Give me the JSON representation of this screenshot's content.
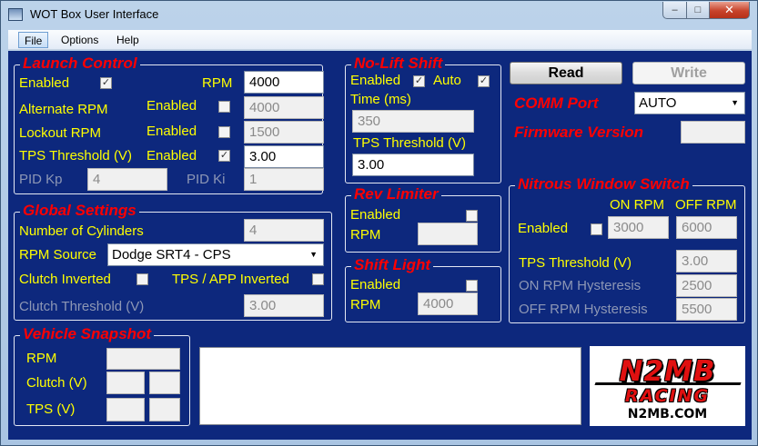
{
  "window": {
    "title": "WOT Box User Interface",
    "minimize": "–",
    "maximize": "□",
    "close": "✕"
  },
  "menu": {
    "file": "File",
    "options": "Options",
    "help": "Help"
  },
  "launch": {
    "title": "Launch Control",
    "enabled_label": "Enabled",
    "enabled_checked": "✓",
    "rpm_label": "RPM",
    "rpm_value": "4000",
    "alt_label": "Alternate RPM",
    "alt_enabled_label": "Enabled",
    "alt_value": "4000",
    "lockout_label": "Lockout  RPM",
    "lockout_enabled_label": "Enabled",
    "lockout_value": "1500",
    "tps_label": "TPS Threshold (V)",
    "tps_enabled_label": "Enabled",
    "tps_checked": "✓",
    "tps_value": "3.00",
    "pidkp_label": "PID Kp",
    "pidkp_value": "4",
    "pidki_label": "PID Ki",
    "pidki_value": "1"
  },
  "global": {
    "title": "Global Settings",
    "cyl_label": "Number of Cylinders",
    "cyl_value": "4",
    "rpm_source_label": "RPM Source",
    "rpm_source_value": "Dodge SRT4 - CPS",
    "clutch_inv_label": "Clutch Inverted",
    "tps_inv_label": "TPS / APP Inverted",
    "clutch_thresh_label": "Clutch Threshold (V)",
    "clutch_thresh_value": "3.00"
  },
  "snapshot": {
    "title": "Vehicle Snapshot",
    "rpm_label": "RPM",
    "clutch_label": "Clutch (V)",
    "tps_label": "TPS (V)"
  },
  "nolift": {
    "title": "No-Lift Shift",
    "enabled_label": "Enabled",
    "enabled_checked": "✓",
    "auto_label": "Auto",
    "auto_checked": "✓",
    "time_label": "Time (ms)",
    "time_value": "350",
    "tps_label": "TPS Threshold (V)",
    "tps_value": "3.00"
  },
  "revlimiter": {
    "title": "Rev Limiter",
    "enabled_label": "Enabled",
    "rpm_label": "RPM"
  },
  "shiftlight": {
    "title": "Shift Light",
    "enabled_label": "Enabled",
    "rpm_label": "RPM",
    "rpm_value": "4000"
  },
  "top": {
    "read_label": "Read",
    "write_label": "Write",
    "comm_label": "COMM Port",
    "comm_value": "AUTO",
    "firmware_label": "Firmware Version"
  },
  "nitrous": {
    "title": "Nitrous Window Switch",
    "on_rpm_header": "ON RPM",
    "off_rpm_header": "OFF RPM",
    "enabled_label": "Enabled",
    "on_rpm_value": "3000",
    "off_rpm_value": "6000",
    "tps_label": "TPS Threshold (V)",
    "tps_value": "3.00",
    "on_hyst_label": "ON RPM Hysteresis",
    "on_hyst_value": "2500",
    "off_hyst_label": "OFF RPM Hysteresis",
    "off_hyst_value": "5500"
  },
  "logo": {
    "brand": "N2MB",
    "racing": "RACING",
    "url": "N2MB.COM"
  }
}
